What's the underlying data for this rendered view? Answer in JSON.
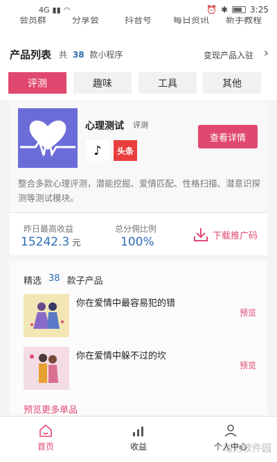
{
  "status_bar": {
    "signal": "4G",
    "time": "3:25"
  },
  "top_nav": {
    "items": [
      "会员群",
      "分享会",
      "抖音号",
      "每日资讯",
      "新手教程"
    ]
  },
  "product_header": {
    "title": "产品列表",
    "count_prefix": "共",
    "count": "38",
    "count_suffix": "款小程序",
    "entry_label": "变现产品入驻"
  },
  "tabs": [
    {
      "label": "评测",
      "active": true
    },
    {
      "label": "趣味",
      "active": false
    },
    {
      "label": "工具",
      "active": false
    },
    {
      "label": "其他",
      "active": false
    }
  ],
  "card": {
    "app_name": "心理测试",
    "app_tag": "评测",
    "platforms": [
      "tiktok-icon",
      "头条"
    ],
    "detail_button": "查看详情",
    "description": "整合多款心理评测，潜能挖掘、爱情匹配、性格扫描、潜意识探测等测试模块。"
  },
  "stats": {
    "yesterday_label": "昨日最高收益",
    "yesterday_value": "15242.3",
    "yesterday_unit": "元",
    "ratio_label": "总分佣比例",
    "ratio_value": "100%",
    "download_label": "下载推广码"
  },
  "featured": {
    "title_prefix": "精选",
    "count": "38",
    "title_suffix": "款子产品",
    "items": [
      {
        "title": "你在爱情中最容易犯的错",
        "action": "预览"
      },
      {
        "title": "你在爱情中躲不过的坎",
        "action": "预览"
      }
    ],
    "more_label": "预览更多单品"
  },
  "bottom_nav": [
    {
      "label": "首页",
      "icon": "home-icon",
      "active": true
    },
    {
      "label": "收益",
      "icon": "chart-icon",
      "active": false
    },
    {
      "label": "个人中心",
      "icon": "user-icon",
      "active": false
    }
  ],
  "colors": {
    "accent": "#e04870",
    "blue": "#2e6db4"
  },
  "watermark": "动力软件园"
}
